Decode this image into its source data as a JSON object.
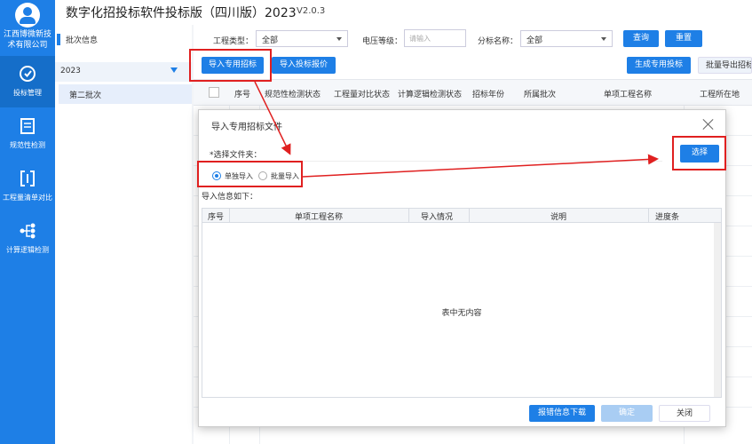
{
  "rail": {
    "company": "江西博微新技术有限公司",
    "items": [
      {
        "label": "投标管理",
        "icon": "bid-management-icon"
      },
      {
        "label": "规范性检测",
        "icon": "document-check-icon"
      },
      {
        "label": "工程量清单对比",
        "icon": "compare-icon"
      },
      {
        "label": "计算逻辑检测",
        "icon": "logic-tree-icon"
      }
    ]
  },
  "header": {
    "title": "数字化招投标软件投标版（四川版）2023",
    "version": "V2.0.3"
  },
  "batch": {
    "heading": "批次信息",
    "year": "2023",
    "selected": "第二批次"
  },
  "filters": {
    "project_type_label": "工程类型：",
    "project_type_value": "全部",
    "voltage_label": "电压等级：",
    "voltage_placeholder": "请输入",
    "section_label": "分标名称：",
    "section_value": "全部",
    "query_label": "查询",
    "reset_label": "重置"
  },
  "toolbar": {
    "import_special_label": "导入专用招标",
    "import_quote_label": "导入投标报价",
    "generate_special_label": "生成专用投标",
    "batch_export_label": "批量导出招标"
  },
  "grid": {
    "columns": [
      "序号",
      "规范性检测状态",
      "工程量对比状态",
      "计算逻辑检测状态",
      "招标年份",
      "所属批次",
      "单项工程名称",
      "工程所在地"
    ]
  },
  "dialog": {
    "title": "导入专用招标文件",
    "folder_label": "*选择文件夹：",
    "choose_label": "选择",
    "radio_single": "单独导入",
    "radio_batch": "批量导入",
    "info_label": "导入信息如下：",
    "columns": [
      "序号",
      "单项工程名称",
      "导入情况",
      "说明",
      "进度条"
    ],
    "empty_text": "表中无内容",
    "download_label": "报错信息下载",
    "confirm_label": "确定",
    "close_label": "关闭"
  }
}
